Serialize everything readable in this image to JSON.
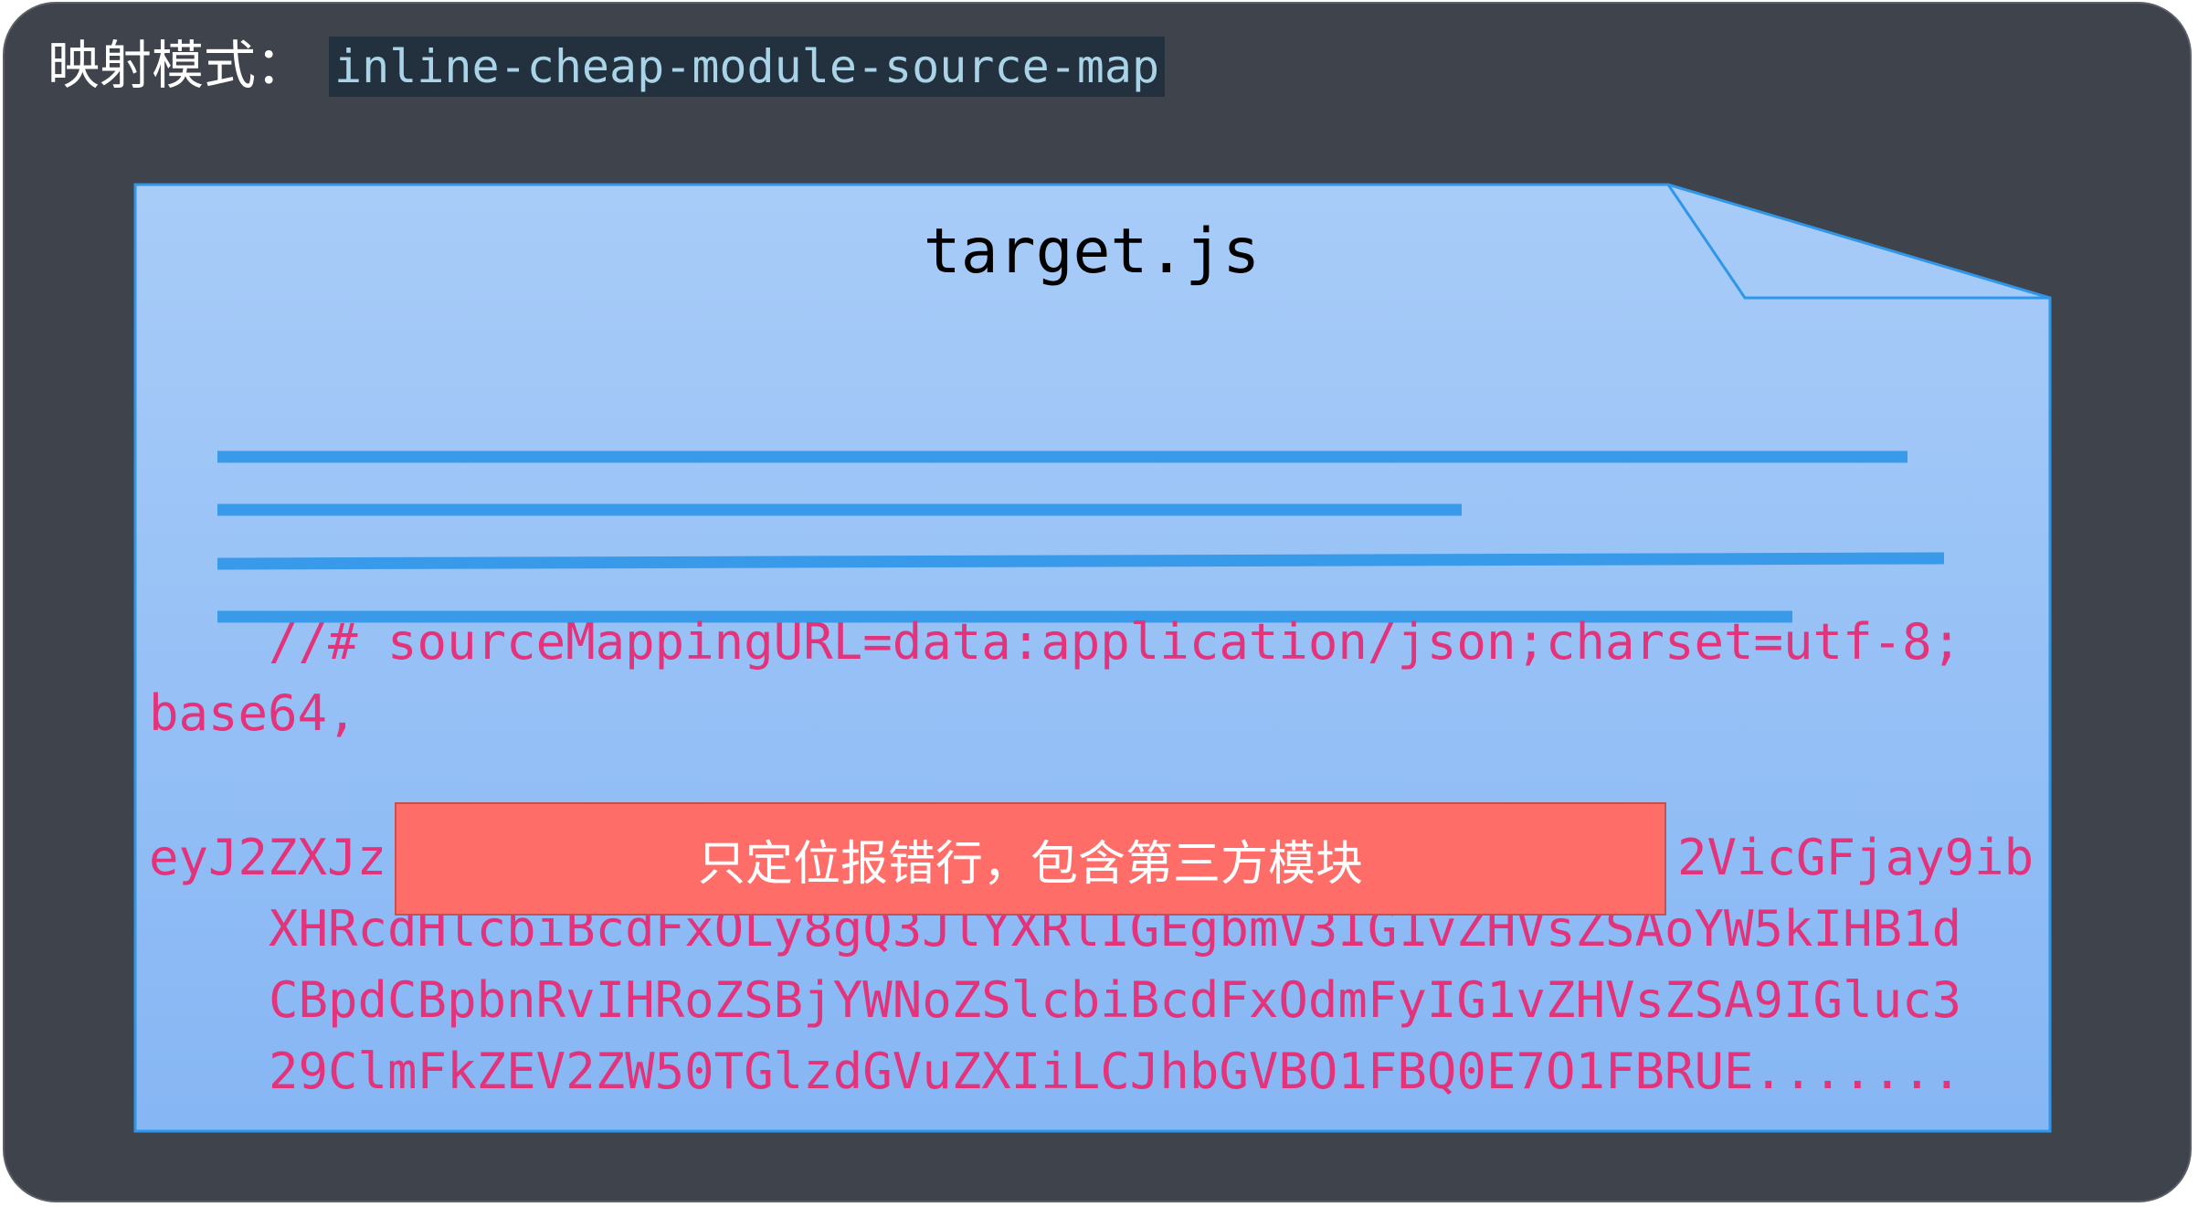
{
  "header": {
    "label": "映射模式：",
    "mode": "inline-cheap-module-source-map"
  },
  "document": {
    "filename": "target.js",
    "code_lines": [
      "//# sourceMappingURL=data:application/json;charset=utf-8;",
      "base64,",
      "eyJ2ZXJz",
      "2VicGFjay9ib",
      "XHRcdHlcbiBcdFxOLy8gQ3JlYXRlIGEgbmV3IG1vZHVsZSAoYW5kIHB1d",
      "CBpdCBpbnRvIHRoZSBjYWNoZSlcbiBcdFxOdmFyIG1vZHVsZSA9IGluc3",
      "29ClmFkZEV2ZW50TGlzdGVuZXIiLCJhbGVBO1FBQ0E7O1FBRUE......."
    ]
  },
  "callout": {
    "text": "只定位报错行，包含第三方模块"
  },
  "colors": {
    "panel_bg": "#3f434c",
    "doc_fill": "#9cc4f6",
    "doc_stroke": "#2f96e8",
    "placeholder_line": "#3a9aea",
    "code_text": "#e2337b",
    "callout_bg": "#ff6d69"
  }
}
